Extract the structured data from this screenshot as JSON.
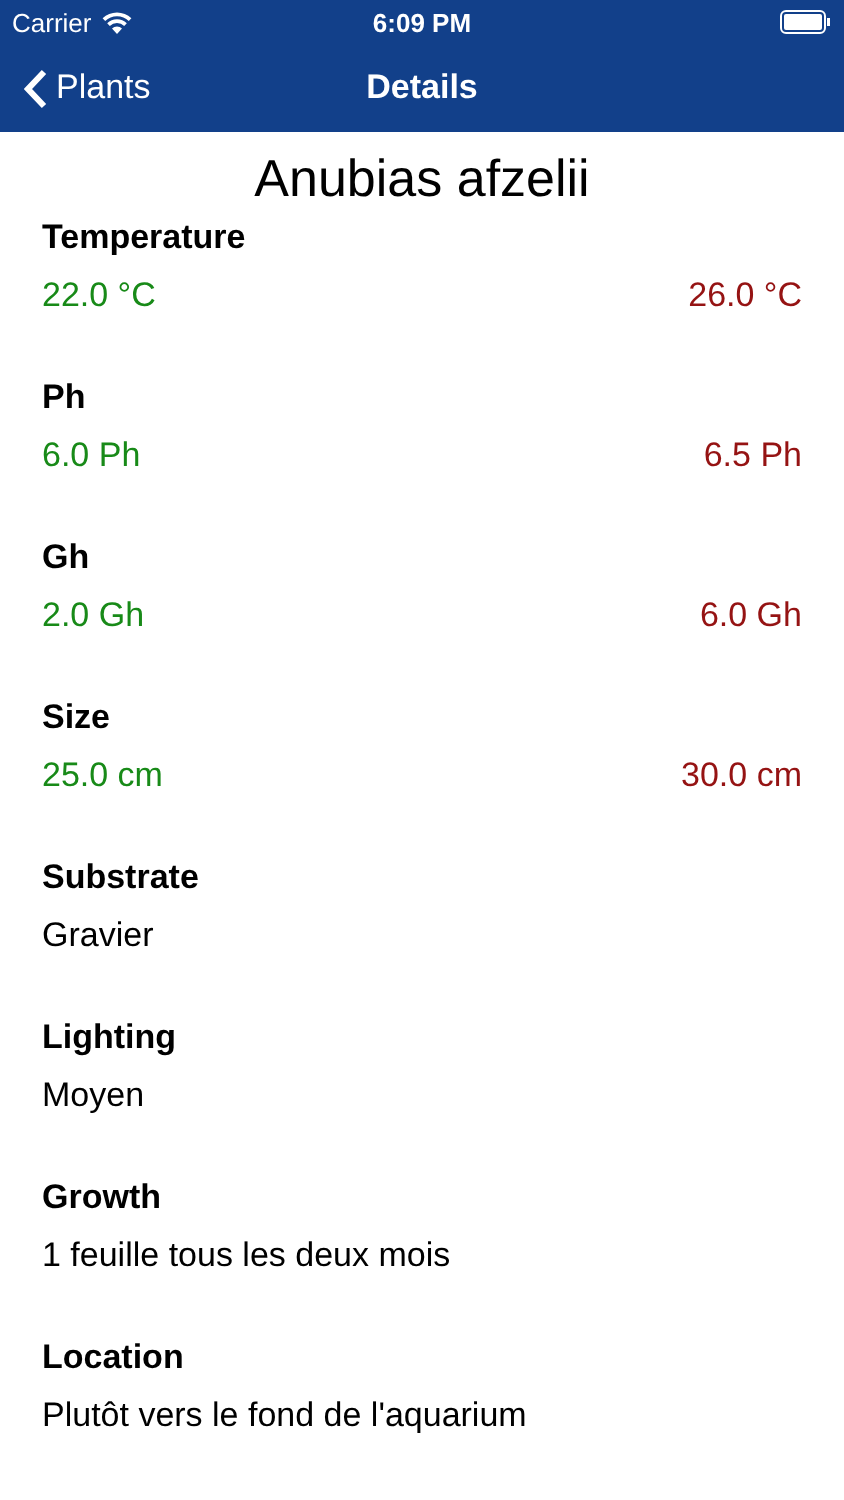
{
  "status_bar": {
    "carrier": "Carrier",
    "time": "6:09 PM"
  },
  "nav_bar": {
    "back": "Plants",
    "title": "Details"
  },
  "plant_name": "Anubias afzelii",
  "sections": [
    {
      "kind": "range",
      "label": "Temperature",
      "min": "22.0 °C",
      "max": "26.0 °C"
    },
    {
      "kind": "range",
      "label": "Ph",
      "min": "6.0 Ph",
      "max": "6.5 Ph"
    },
    {
      "kind": "range",
      "label": "Gh",
      "min": "2.0 Gh",
      "max": "6.0 Gh"
    },
    {
      "kind": "range",
      "label": "Size",
      "min": "25.0 cm",
      "max": "30.0 cm"
    },
    {
      "kind": "text",
      "label": "Substrate",
      "value": "Gravier"
    },
    {
      "kind": "text",
      "label": "Lighting",
      "value": "Moyen"
    },
    {
      "kind": "text",
      "label": "Growth",
      "value": "1 feuille tous les deux mois"
    },
    {
      "kind": "text",
      "label": "Location",
      "value": "Plutôt vers le fond de l'aquarium"
    }
  ]
}
